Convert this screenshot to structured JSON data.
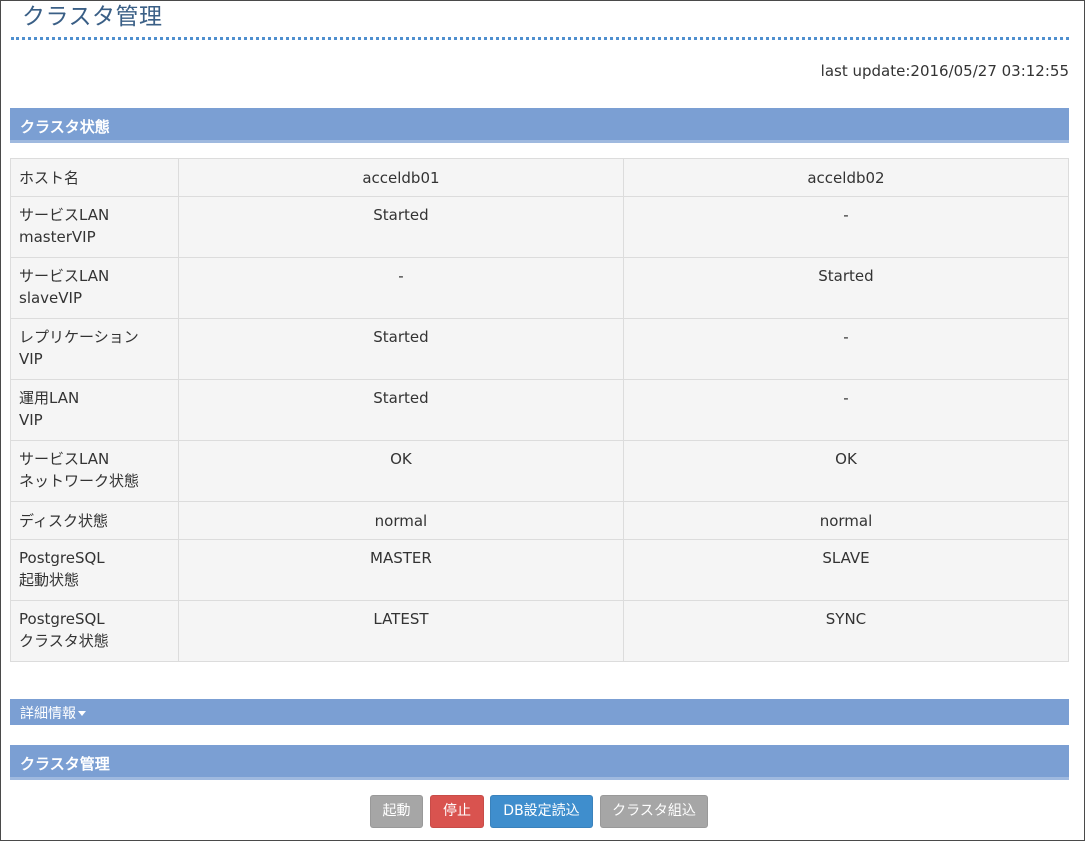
{
  "page": {
    "title": "クラスタ管理",
    "last_update": "last update:2016/05/27 03:12:55"
  },
  "sections": {
    "cluster_state": "クラスタ状態",
    "detail_info": "詳細情報",
    "cluster_manage": "クラスタ管理"
  },
  "table": {
    "rows": [
      {
        "label1": "ホスト名",
        "label2": "",
        "v1": "acceldb01",
        "v2": "acceldb02"
      },
      {
        "label1": "サービスLAN",
        "label2": "masterVIP",
        "v1": "Started",
        "v2": "-"
      },
      {
        "label1": "サービスLAN",
        "label2": "slaveVIP",
        "v1": "-",
        "v2": "Started"
      },
      {
        "label1": "レプリケーション",
        "label2": "VIP",
        "v1": "Started",
        "v2": "-"
      },
      {
        "label1": "運用LAN",
        "label2": "VIP",
        "v1": "Started",
        "v2": "-"
      },
      {
        "label1": "サービスLAN",
        "label2": "ネットワーク状態",
        "v1": "OK",
        "v2": "OK"
      },
      {
        "label1": "ディスク状態",
        "label2": "",
        "v1": "normal",
        "v2": "normal"
      },
      {
        "label1": "PostgreSQL",
        "label2": "起動状態",
        "v1": "MASTER",
        "v2": "SLAVE"
      },
      {
        "label1": "PostgreSQL",
        "label2": "クラスタ状態",
        "v1": "LATEST",
        "v2": "SYNC"
      }
    ]
  },
  "buttons": {
    "start": "起動",
    "stop": "停止",
    "db_reload": "DB設定読込",
    "assemble": "クラスタ組込"
  },
  "colors": {
    "section_bar": "#7b9fd3",
    "title_text": "#3a5f86",
    "stop_button": "#d9534f",
    "db_button": "#3f8ecd",
    "disabled_button": "#a6a6a6"
  }
}
